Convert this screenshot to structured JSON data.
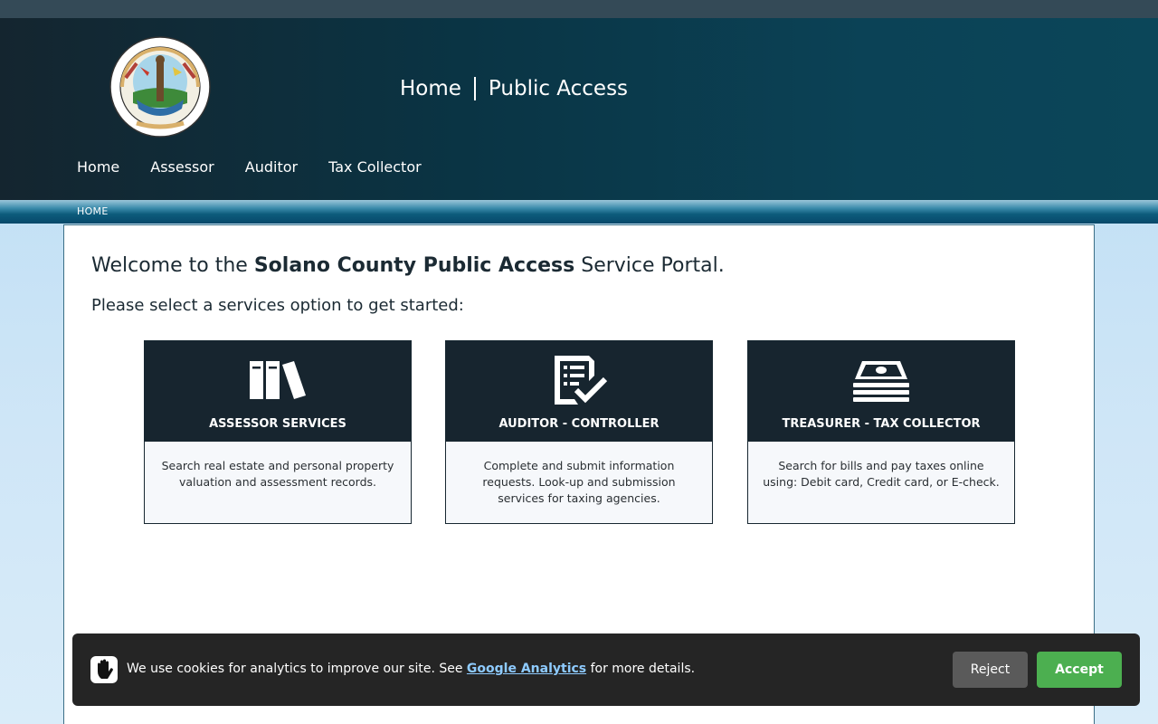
{
  "header": {
    "logo_icon": "solano-county-seal",
    "title_home": "Home",
    "title_section": "Public Access"
  },
  "nav": {
    "items": [
      {
        "label": "Home"
      },
      {
        "label": "Assessor"
      },
      {
        "label": "Auditor"
      },
      {
        "label": "Tax Collector"
      }
    ]
  },
  "breadcrumb": {
    "current": "HOME"
  },
  "main": {
    "welcome_prefix": "Welcome to the ",
    "welcome_bold": "Solano County Public Access",
    "welcome_suffix": " Service Portal.",
    "prompt": "Please select a services option to get started:"
  },
  "cards": [
    {
      "icon": "books-icon",
      "title": "ASSESSOR SERVICES",
      "description": "Search real estate and personal property valuation and assessment records."
    },
    {
      "icon": "checklist-icon",
      "title": "AUDITOR - CONTROLLER",
      "description": "Complete and submit information requests. Look-up and submission services for taxing agencies."
    },
    {
      "icon": "money-stack-icon",
      "title": "TREASURER - TAX COLLECTOR",
      "description": "Search for bills and pay taxes online using: Debit card, Credit card, or E-check."
    }
  ],
  "cookie": {
    "icon": "hand-stop-icon",
    "text_before": "We use cookies for analytics to improve our site. See ",
    "link": "Google Analytics",
    "text_after": " for more details.",
    "reject_label": "Reject",
    "accept_label": "Accept"
  },
  "colors": {
    "header_dark": "#0a3444",
    "card_head": "#17252f",
    "accept_green": "#4caf50",
    "reject_gray": "#5a5a5a",
    "link_blue": "#8ecbff"
  }
}
